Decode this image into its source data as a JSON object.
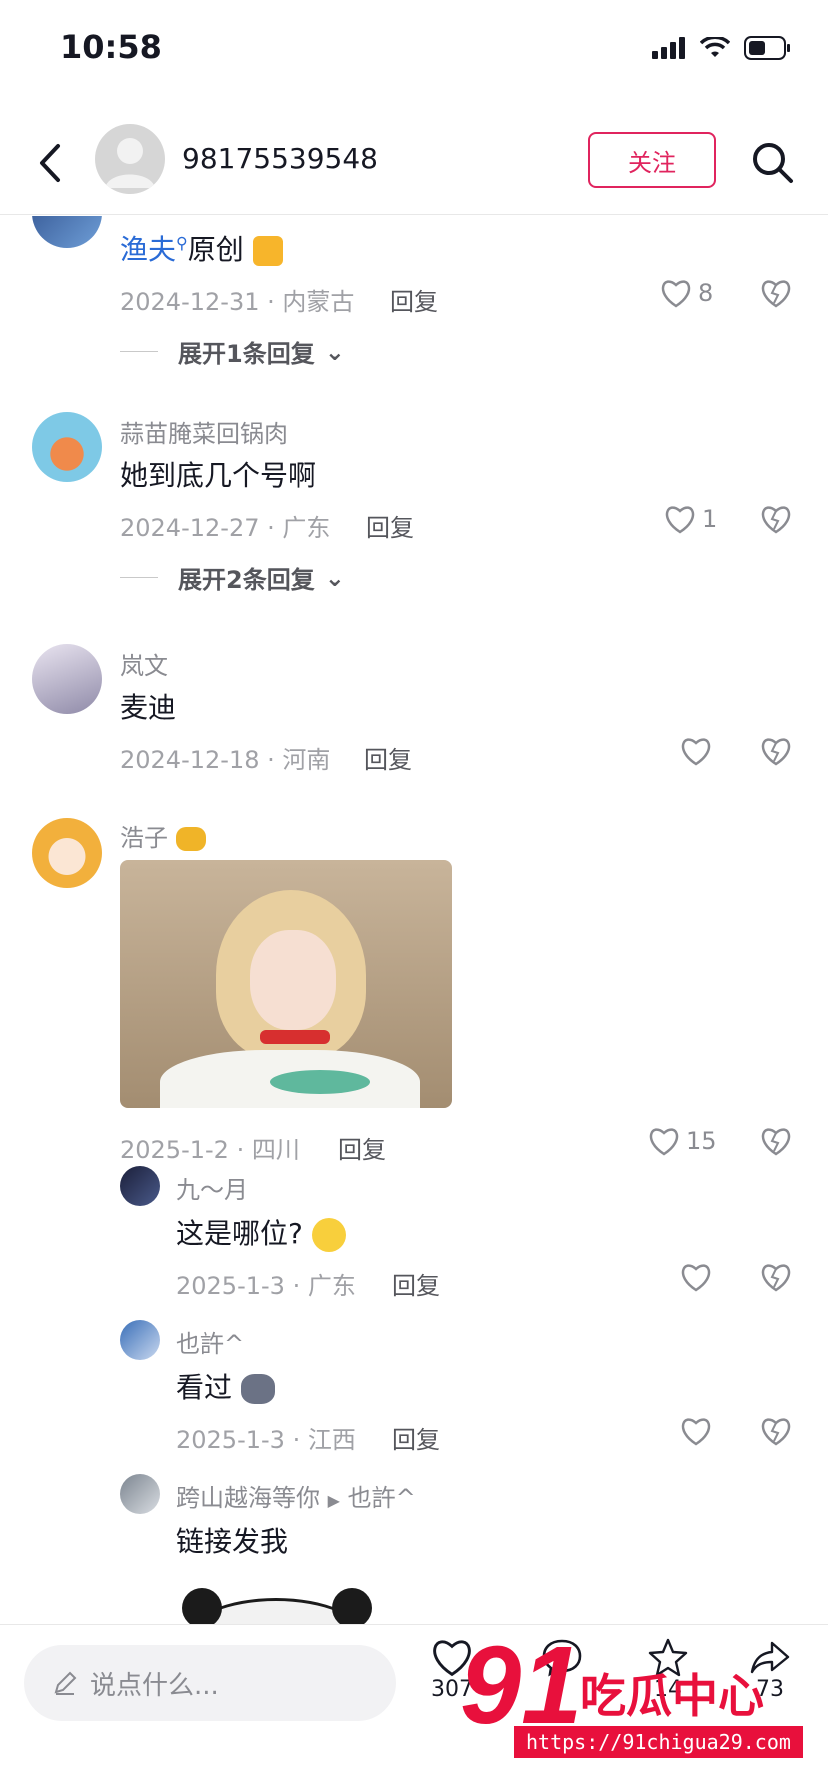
{
  "status": {
    "time": "10:58"
  },
  "header": {
    "username": "98175539548",
    "follow_label": "关注"
  },
  "comments": [
    {
      "user": "渔夫",
      "text": "原创",
      "date": "2024-12-31",
      "region": "内蒙古",
      "reply": "回复",
      "likes": "8",
      "expand": "展开1条回复"
    },
    {
      "user": "蒜苗腌菜回锅肉",
      "text": "她到底几个号啊",
      "date": "2024-12-27",
      "region": "广东",
      "reply": "回复",
      "likes": "1",
      "expand": "展开2条回复"
    },
    {
      "user": "岚文",
      "text": "麦迪",
      "date": "2024-12-18",
      "region": "河南",
      "reply": "回复",
      "likes": ""
    },
    {
      "user": "浩子",
      "date": "2025-1-2",
      "region": "四川",
      "reply": "回复",
      "likes": "15"
    }
  ],
  "replies": [
    {
      "user": "九～月",
      "text": "这是哪位?",
      "date": "2025-1-3",
      "region": "广东",
      "reply": "回复"
    },
    {
      "user": "也許^",
      "text": "看过",
      "date": "2025-1-3",
      "region": "江西",
      "reply": "回复"
    },
    {
      "user": "跨山越海等你",
      "reply_to": "也許^",
      "text": "链接发我"
    }
  ],
  "bottom_bar": {
    "placeholder": "说点什么...",
    "like_count": "307",
    "comment_count": "",
    "star_count": "14",
    "share_count": "73"
  },
  "watermark": {
    "number": "91",
    "name": "吃瓜中心",
    "url": "https://91chigua29.com"
  },
  "colors": {
    "accent": "#e0245e",
    "watermark": "#e8103c",
    "link_blue": "#2a6bd6"
  }
}
